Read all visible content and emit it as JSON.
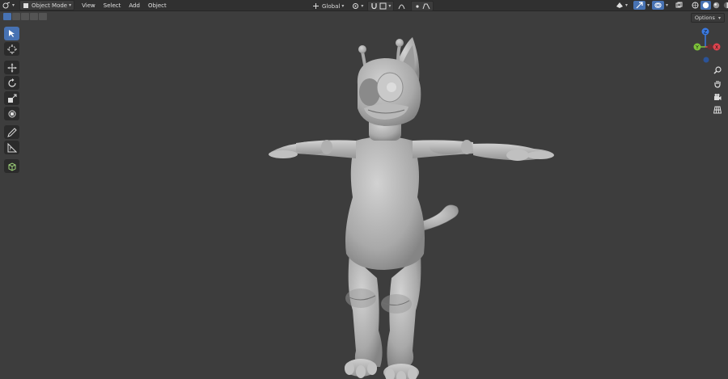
{
  "header": {
    "mode": "Object Mode",
    "menus": [
      "View",
      "Select",
      "Add",
      "Object"
    ],
    "transform_orientation": "Global"
  },
  "viewport": {
    "options_label": "Options",
    "axes": {
      "x": "X",
      "y": "Y",
      "z": "Z"
    }
  },
  "colors": {
    "accent": "#4772b3",
    "axis_x": "#e0434e",
    "axis_y": "#7cc239",
    "axis_z": "#3a7ae2",
    "background": "#3d3d3d",
    "model": "#b9b9b9"
  }
}
